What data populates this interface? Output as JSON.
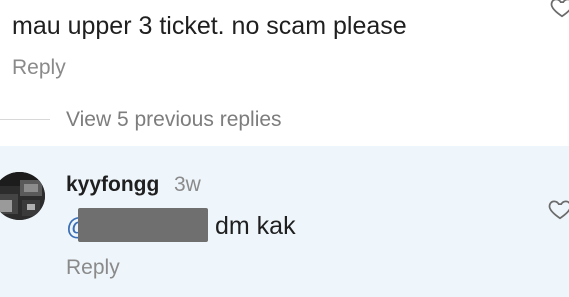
{
  "top_comment": {
    "text": "mau upper 3 ticket. no scam please",
    "reply_label": "Reply",
    "like_icon": "heart-outline-icon"
  },
  "thread": {
    "view_previous_label": "View 5 previous replies"
  },
  "reply": {
    "username": "kyyfongg",
    "timestamp": "3w",
    "mention_prefix": "@",
    "text": "dm kak",
    "reply_label": "Reply",
    "like_icon": "heart-outline-icon",
    "highlight_color": "#eef6fb"
  }
}
